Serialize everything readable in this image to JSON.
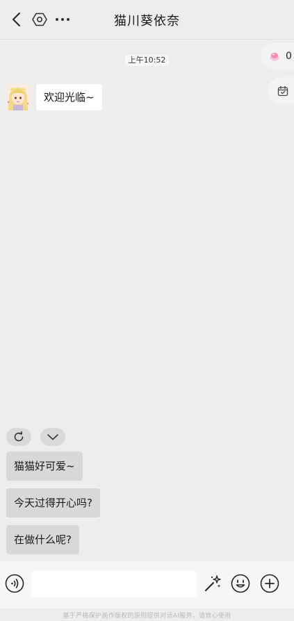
{
  "header": {
    "title": "猫川葵依奈",
    "back_icon": "chevron-left-icon",
    "settings_icon": "hexagon-settings-icon",
    "more_icon": "more-dots-icon"
  },
  "chat": {
    "timestamp": "上午10:52",
    "messages": [
      {
        "sender": "bot",
        "text": "欢迎光临~"
      }
    ]
  },
  "side_chips": {
    "candy_count": "0",
    "candy_icon": "candy-icon",
    "calendar_icon": "calendar-check-icon"
  },
  "quick_actions": {
    "refresh_icon": "refresh-icon",
    "collapse_icon": "chevron-down-icon",
    "suggestions": [
      "猫猫好可爱~",
      "今天过得开心吗?",
      "在做什么呢?"
    ]
  },
  "input_bar": {
    "value": "",
    "placeholder": "",
    "voice_icon": "voice-icon",
    "magic_icon": "magic-wand-icon",
    "emoji_icon": "emoji-icon",
    "plus_icon": "plus-circle-icon"
  },
  "footer": {
    "disclaimer": "基于严格保护画作版权的原则提供对话AI服务，请放心使用"
  },
  "colors": {
    "background": "#ededed",
    "bubble": "#ffffff",
    "suggestion": "#d8d8d8",
    "candy_pink": "#f28bb5"
  }
}
